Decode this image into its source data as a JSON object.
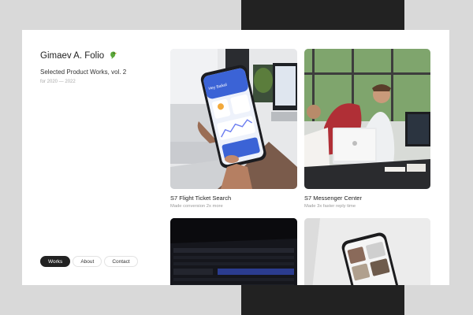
{
  "header": {
    "name": "Gimaev A. Folio",
    "subtitle": "Selected Product Works, vol. 2",
    "years": "for 2020 — 2022"
  },
  "nav": {
    "items": [
      {
        "label": "Works",
        "active": true
      },
      {
        "label": "About",
        "active": false
      },
      {
        "label": "Contact",
        "active": false
      }
    ]
  },
  "projects": [
    {
      "title": "S7 Flight Ticket Search",
      "description": "Made conversion 2x more"
    },
    {
      "title": "S7 Messenger Center",
      "description": "Made 3x faster reply time"
    }
  ],
  "thumbnails": {
    "phone_screen_heading": "Hey Baikal"
  },
  "colors": {
    "background": "#d9d9d9",
    "card": "#ffffff",
    "dark_block": "#222222",
    "active_nav": "#222222"
  },
  "icons": [
    "parrot-icon"
  ]
}
